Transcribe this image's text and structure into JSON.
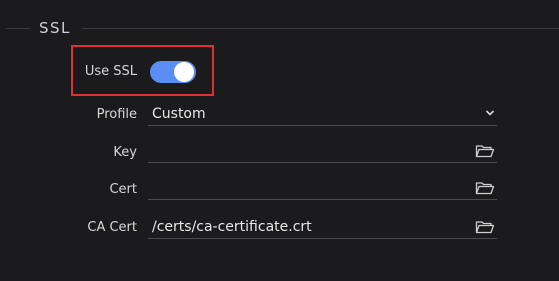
{
  "section": {
    "title": "SSL"
  },
  "use_ssl": {
    "label": "Use SSL",
    "enabled": true
  },
  "profile": {
    "label": "Profile",
    "value": "Custom"
  },
  "key": {
    "label": "Key",
    "value": ""
  },
  "cert": {
    "label": "Cert",
    "value": ""
  },
  "ca_cert": {
    "label": "CA Cert",
    "value": "/certs/ca-certificate.crt"
  },
  "colors": {
    "background": "#1b1b1d",
    "toggle_on": "#5b8ef5",
    "highlight": "#e03131"
  },
  "icons": {
    "browse": "folder-open-icon",
    "dropdown": "chevron-down-icon"
  }
}
